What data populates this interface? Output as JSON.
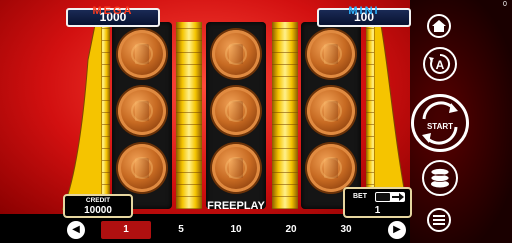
{
  "jackpots": {
    "mega": {
      "label": "MEGA",
      "value": "1000",
      "label_color": "#ff3b1f"
    },
    "mini": {
      "label": "MINI",
      "value": "100",
      "label_color": "#2fb4ff"
    }
  },
  "credit": {
    "label": "CREDIT",
    "value": "10000"
  },
  "mode_text": "FREEPLAY",
  "bet": {
    "label": "BET",
    "value": "1"
  },
  "bet_options": [
    "1",
    "5",
    "10",
    "20",
    "30"
  ],
  "selected_bet": "1",
  "side_buttons": {
    "start_label": "START"
  },
  "corner_counter": "0",
  "reels": [
    {
      "symbols": [
        "coin",
        "coin",
        "coin"
      ]
    },
    {
      "symbols": [
        "coin",
        "coin",
        "coin"
      ]
    },
    {
      "symbols": [
        "coin",
        "coin",
        "coin"
      ]
    }
  ],
  "colors": {
    "background": "#d21010",
    "frame_gold": "#f5c400",
    "active_bet": "#b01010"
  }
}
